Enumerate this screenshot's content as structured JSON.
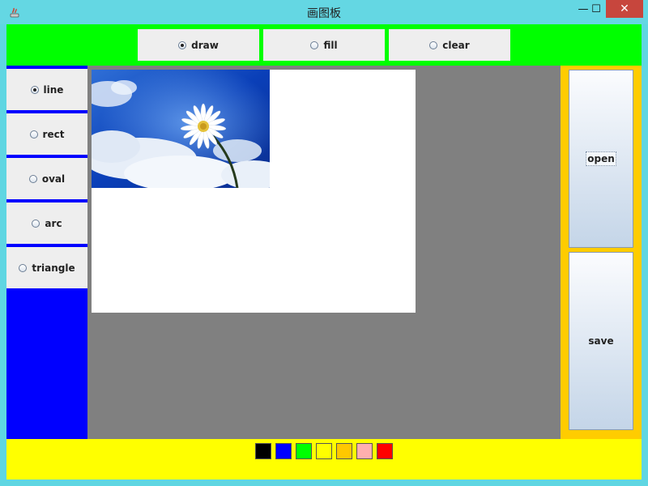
{
  "window": {
    "title": "画图板",
    "minimize": "—",
    "maximize": "☐",
    "close": "✕"
  },
  "modes": [
    {
      "label": "draw",
      "checked": true
    },
    {
      "label": "fill",
      "checked": false
    },
    {
      "label": "clear",
      "checked": false
    }
  ],
  "shapes": [
    {
      "label": "line",
      "checked": true
    },
    {
      "label": "rect",
      "checked": false
    },
    {
      "label": "oval",
      "checked": false
    },
    {
      "label": "arc",
      "checked": false
    },
    {
      "label": "triangle",
      "checked": false
    }
  ],
  "actions": {
    "open_label": "open",
    "save_label": "save"
  },
  "colors": {
    "title_bar": "#64d7e3",
    "top_panel": "#00ff00",
    "left_panel": "#0000ff",
    "canvas_bg": "#808080",
    "right_panel": "#ffcc00",
    "bottom_panel": "#ffff00"
  },
  "palette": [
    "#000000",
    "#0000ff",
    "#00ff00",
    "#ffff00",
    "#ffc800",
    "#ffafaf",
    "#ff0000"
  ]
}
